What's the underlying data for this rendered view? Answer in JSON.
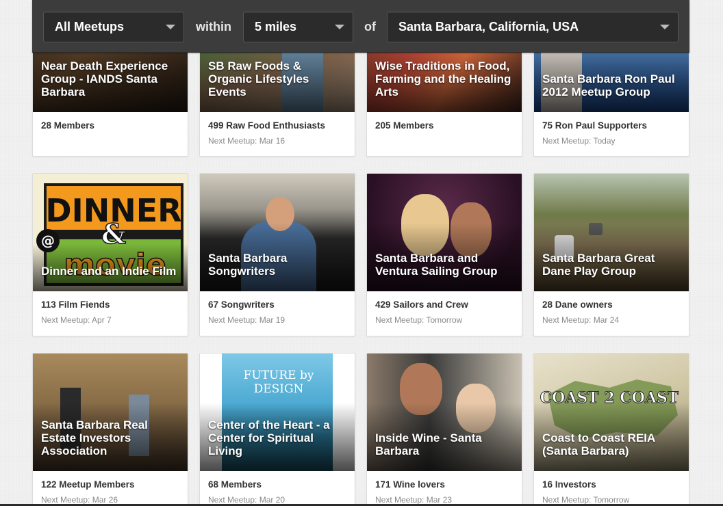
{
  "filters": {
    "category": "All Meetups",
    "within_label": "within",
    "distance": "5 miles",
    "of_label": "of",
    "location": "Santa Barbara, California, USA"
  },
  "cards": [
    {
      "title": "Near Death Experience Group - IANDS Santa Barbara",
      "members": "28 Members",
      "next": ""
    },
    {
      "title": "SB Raw Foods & Organic Lifestyles Events",
      "members": "499 Raw Food Enthusiasts",
      "next": "Next Meetup: Mar 16"
    },
    {
      "title": "Wise Traditions in Food, Farming and the Healing Arts",
      "members": "205 Members",
      "next": ""
    },
    {
      "title": "Santa Barbara Ron Paul 2012 Meetup Group",
      "members": "75 Ron Paul Supporters",
      "next": "Next Meetup: Today"
    },
    {
      "title": "Dinner and an Indie Film",
      "members": "113 Film Fiends",
      "next": "Next Meetup: Apr 7"
    },
    {
      "title": "Santa Barbara Songwriters",
      "members": "67 Songwriters",
      "next": "Next Meetup: Mar 19"
    },
    {
      "title": "Santa Barbara and Ventura Sailing Group",
      "members": "429 Sailors and Crew",
      "next": "Next Meetup: Tomorrow"
    },
    {
      "title": "Santa Barbara Great Dane Play Group",
      "members": "28 Dane owners",
      "next": "Next Meetup: Mar 24"
    },
    {
      "title": "Santa Barbara Real Estate Investors Association",
      "members": "122 Meetup Members",
      "next": "Next Meetup: Mar 26"
    },
    {
      "title": "Center of the Heart - a Center for Spiritual Living",
      "members": "68 Members",
      "next": "Next Meetup: Mar 20"
    },
    {
      "title": "Inside Wine - Santa Barbara",
      "members": "171 Wine lovers",
      "next": "Next Meetup: Mar 23"
    },
    {
      "title": "Coast to Coast REIA (Santa Barbara)",
      "members": "16 Investors",
      "next": "Next Meetup: Tomorrow"
    }
  ],
  "photo_text": {
    "dinner_logo_top": "DINNER",
    "dinner_logo_amp": "&",
    "dinner_logo_at": "@",
    "dinner_logo_bottom": "movie",
    "future_design": "FUTURE by DESIGN",
    "coast_logo": "COAST 2 COAST"
  }
}
